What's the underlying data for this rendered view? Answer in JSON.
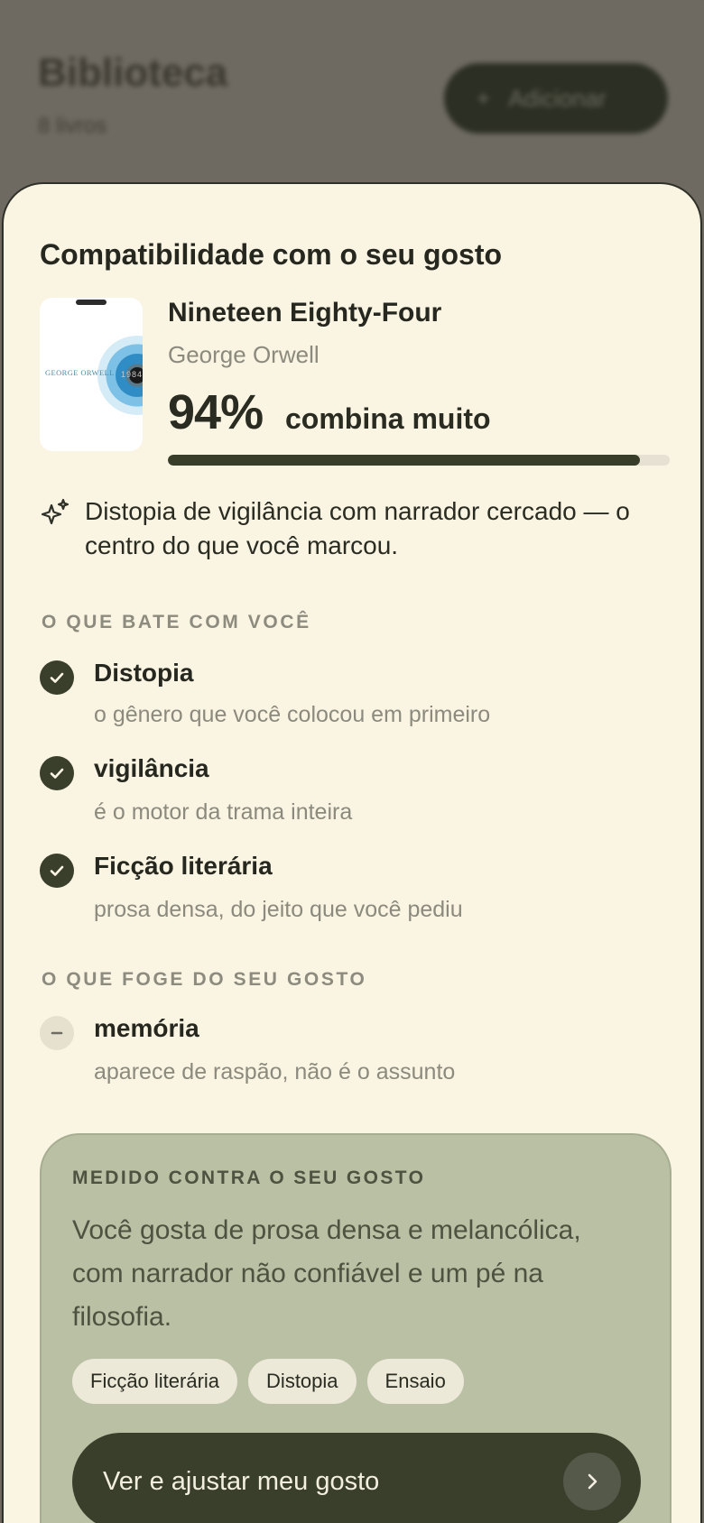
{
  "background": {
    "title": "Biblioteca",
    "count": "8 livros",
    "add_button": "Adicionar"
  },
  "sheet": {
    "title": "Compatibilidade com o seu gosto",
    "book": {
      "title": "Nineteen Eighty-Four",
      "author": "George Orwell",
      "cover_author": "GEORGE ORWELL",
      "cover_year": "1984",
      "match_percent_text": "94%",
      "match_label": "combina muito",
      "match_fraction": 0.94
    },
    "insight": "Distopia de vigilância com narrador cercado — o centro do que você marcou.",
    "matches_label": "O QUE BATE COM VOCÊ",
    "matches": [
      {
        "title": "Distopia",
        "subtitle": "o gênero que você colocou em primeiro"
      },
      {
        "title": "vigilância",
        "subtitle": "é o motor da trama inteira"
      },
      {
        "title": "Ficção literária",
        "subtitle": "prosa densa, do jeito que você pediu"
      }
    ],
    "mismatches_label": "O QUE FOGE DO SEU GOSTO",
    "mismatches": [
      {
        "title": "memória",
        "subtitle": "aparece de raspão, não é o assunto"
      }
    ],
    "taste_card": {
      "label": "MEDIDO CONTRA O SEU GOSTO",
      "text": "Você gosta de prosa densa e melancólica, com narrador não confiável e um pé na filosofia.",
      "chips": [
        "Ficção literária",
        "Distopia",
        "Ensaio"
      ],
      "cta_label": "Ver e ajustar meu gosto"
    }
  },
  "colors": {
    "sheet_bg": "#faf4e3",
    "accent_dark": "#3a3f2c",
    "card_bg": "#bac0a4",
    "muted_text": "#8b8a7d"
  }
}
